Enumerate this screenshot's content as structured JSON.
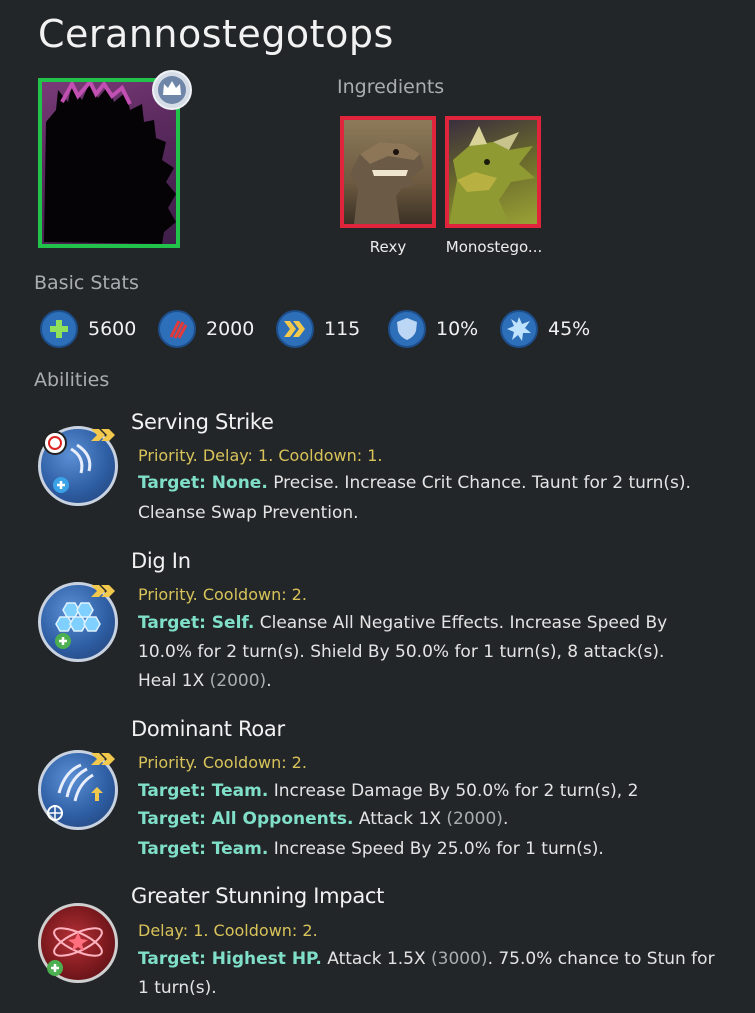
{
  "title": "Cerannostegotops",
  "ingredients_label": "Ingredients",
  "ingredients": [
    {
      "name": "Rexy"
    },
    {
      "name": "Monostego..."
    }
  ],
  "basic_stats_label": "Basic Stats",
  "stats": {
    "health": "5600",
    "damage": "2000",
    "speed": "115",
    "armor": "10%",
    "crit": "45%"
  },
  "abilities_label": "Abilities",
  "abilities": [
    {
      "name": "Serving Strike",
      "meta": "Priority. Delay: 1. Cooldown: 1.",
      "lines": [
        {
          "target": "Target: None.",
          "text": " Precise. Increase Crit Chance. Taunt for 2 turn(s)."
        },
        {
          "target": "",
          "text": "Cleanse Swap Prevention."
        }
      ]
    },
    {
      "name": "Dig In",
      "meta": "Priority. Cooldown: 2.",
      "lines": [
        {
          "target": "Target: Self.",
          "text": " Cleanse All Negative Effects. Increase Speed By"
        },
        {
          "target": "",
          "text": "10.0% for 2 turn(s). Shield By 50.0% for 1 turn(s), 8 attack(s)."
        },
        {
          "target": "",
          "text": "Heal 1X ",
          "num": "(2000)",
          "tail": "."
        }
      ]
    },
    {
      "name": "Dominant Roar",
      "meta": "Priority. Cooldown: 2.",
      "lines": [
        {
          "target": "Target: Team.",
          "text": " Increase Damage By 50.0% for 2 turn(s), 2"
        },
        {
          "target": "Target: All Opponents.",
          "text": " Attack 1X ",
          "num": "(2000)",
          "tail": "."
        },
        {
          "target": "Target: Team.",
          "text": " Increase Speed By 25.0% for 1 turn(s)."
        }
      ]
    },
    {
      "name": "Greater Stunning Impact",
      "meta": "Delay: 1. Cooldown: 2.",
      "lines": [
        {
          "target": "Target: Highest HP.",
          "text": " Attack 1.5X ",
          "num": "(3000)",
          "tail": ". 75.0% chance to Stun for"
        },
        {
          "target": "",
          "text": "1 turn(s)."
        }
      ]
    }
  ],
  "colors": {
    "background": "#232629",
    "creature_border": "#22c34a",
    "ingredient_border": "#e0243c",
    "stat_icon": "#2d6fb8",
    "meta_text": "#d8c35a",
    "target_text": "#7fdfc8"
  }
}
